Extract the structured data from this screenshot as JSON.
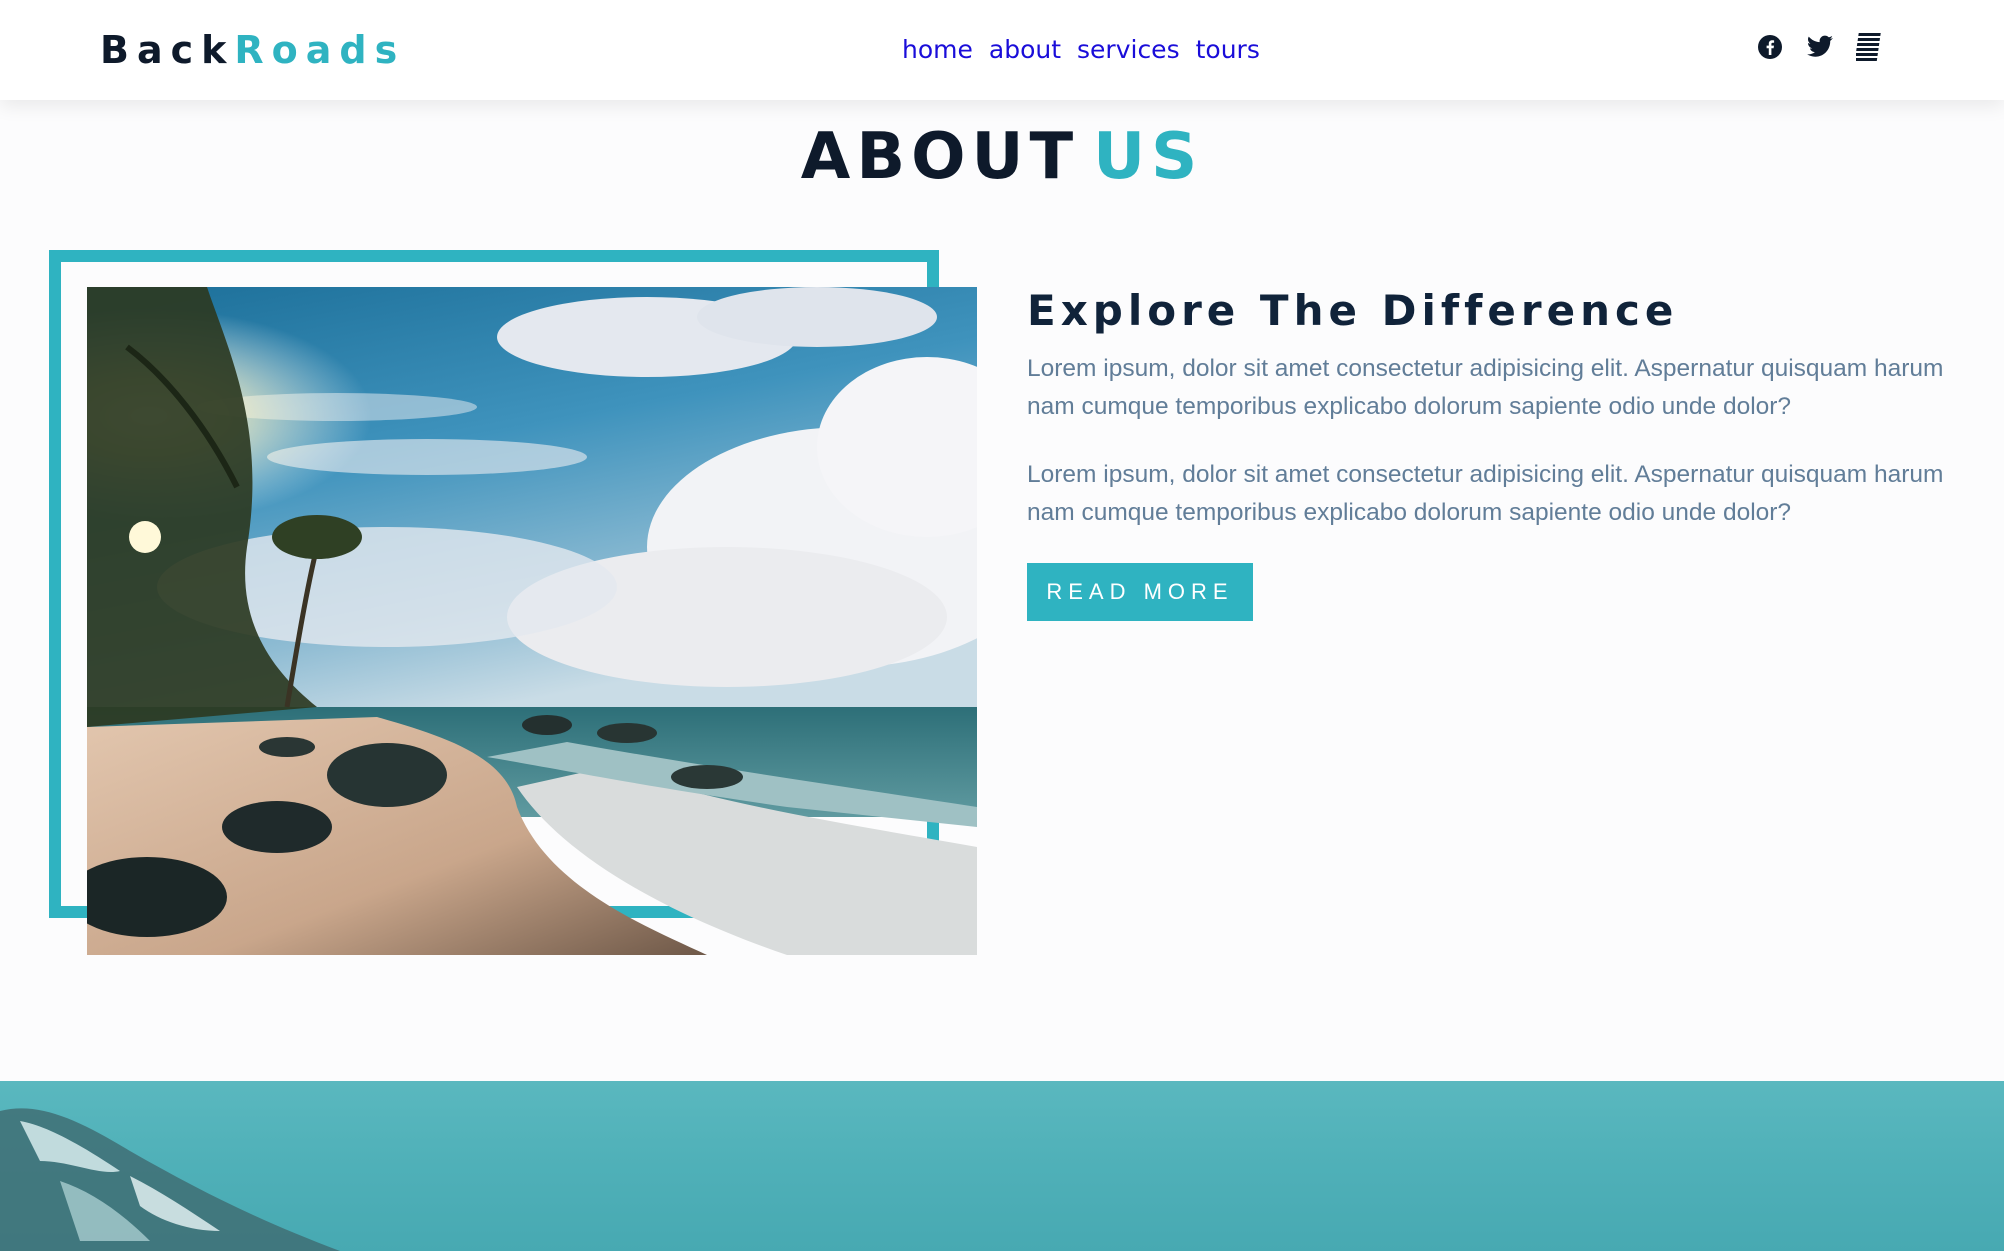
{
  "navbar": {
    "logo": {
      "part1": "Back",
      "part2": "Roads"
    },
    "links": [
      {
        "label": "home"
      },
      {
        "label": "about"
      },
      {
        "label": "services"
      },
      {
        "label": "tours"
      }
    ],
    "icons": [
      "facebook-icon",
      "twitter-icon",
      "squarespace-icon"
    ]
  },
  "section": {
    "title_part1": "ABOUT",
    "title_part2": "US"
  },
  "about": {
    "heading": "Explore The Difference",
    "paragraphs": [
      "Lorem ipsum, dolor sit amet consectetur adipisicing elit. Aspernatur quisquam harum nam cumque temporibus explicabo dolorum sapiente odio unde dolor?",
      "Lorem ipsum, dolor sit amet consectetur adipisicing elit. Aspernatur quisquam harum nam cumque temporibus explicabo dolorum sapiente odio unde dolor?"
    ],
    "button_label": "READ MORE"
  },
  "colors": {
    "accent": "#2fb3c1",
    "dark": "#0e1a2b",
    "link": "#1a0dd9",
    "text_muted": "#617d98"
  }
}
